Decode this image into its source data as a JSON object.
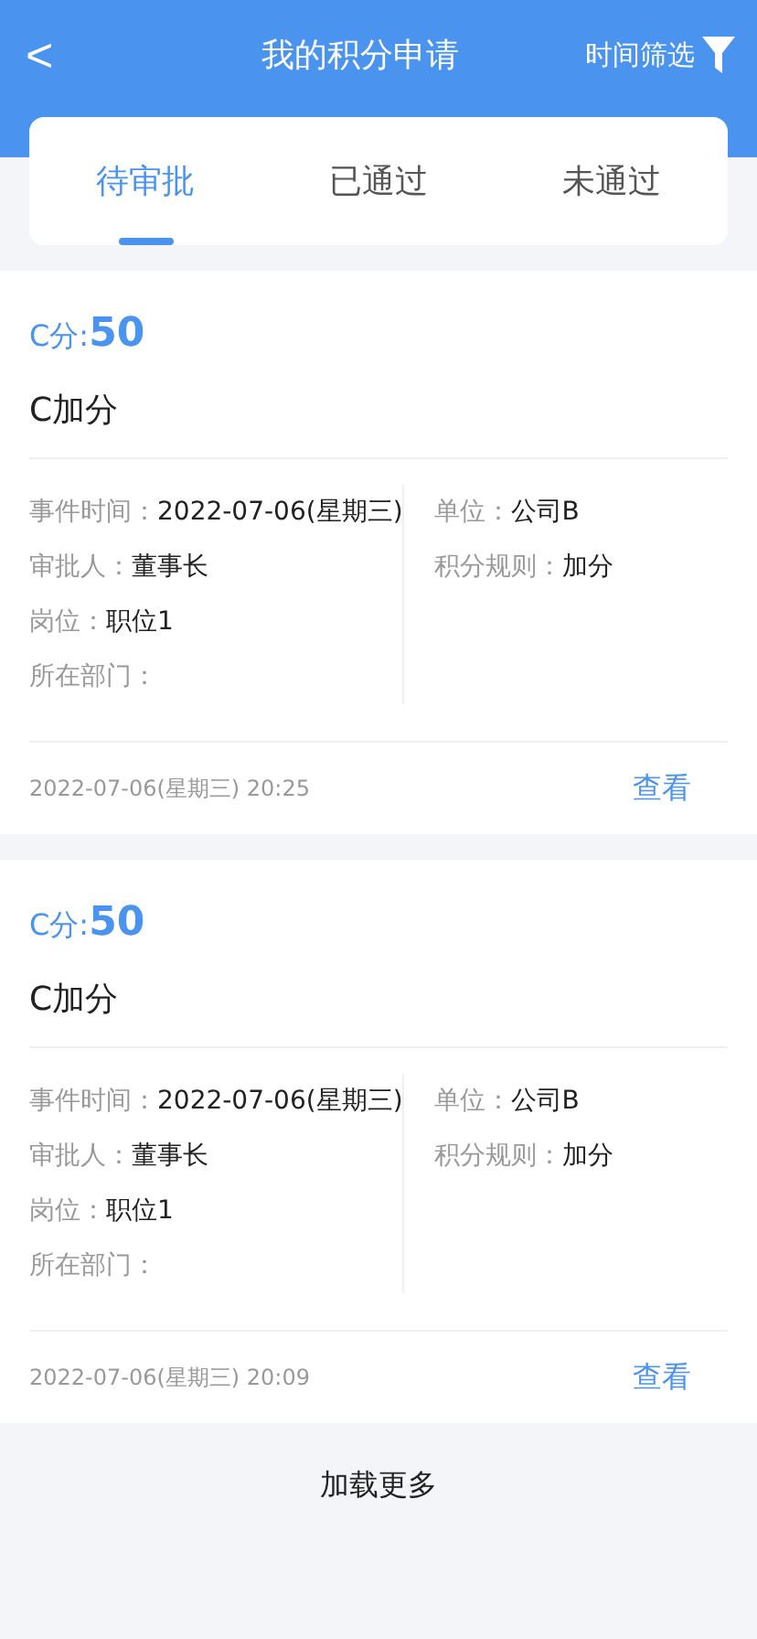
{
  "header": {
    "back": "<",
    "title": "我的积分申请",
    "filter": "时间筛选"
  },
  "tabs": [
    {
      "label": "待审批",
      "selected": true
    },
    {
      "label": "已通过",
      "selected": false
    },
    {
      "label": "未通过",
      "selected": false
    }
  ],
  "cards": [
    {
      "score_label": "C分:",
      "score": "50",
      "title": "C加分",
      "left": [
        {
          "label": "事件时间：",
          "value": "2022-07-06(星期三)"
        },
        {
          "label": "审批人：",
          "value": "董事长"
        },
        {
          "label": "岗位：",
          "value": "职位1"
        },
        {
          "label": "所在部门："
        }
      ],
      "right": [
        {
          "label": "单位：",
          "value": "公司B"
        },
        {
          "label": "积分规则：",
          "value": "加分"
        }
      ],
      "time": "2022-07-06(星期三) 20:25",
      "action": "查看"
    },
    {
      "score_label": "C分:",
      "score": "50",
      "title": "C加分",
      "left": [
        {
          "label": "事件时间：",
          "value": "2022-07-06(星期三)"
        },
        {
          "label": "审批人：",
          "value": "董事长"
        },
        {
          "label": "岗位：",
          "value": "职位1"
        },
        {
          "label": "所在部门："
        }
      ],
      "right": [
        {
          "label": "单位：",
          "value": "公司B"
        },
        {
          "label": "积分规则：",
          "value": "加分"
        }
      ],
      "time": "2022-07-06(星期三) 20:09",
      "action": "查看"
    }
  ],
  "load_more": "加载更多"
}
